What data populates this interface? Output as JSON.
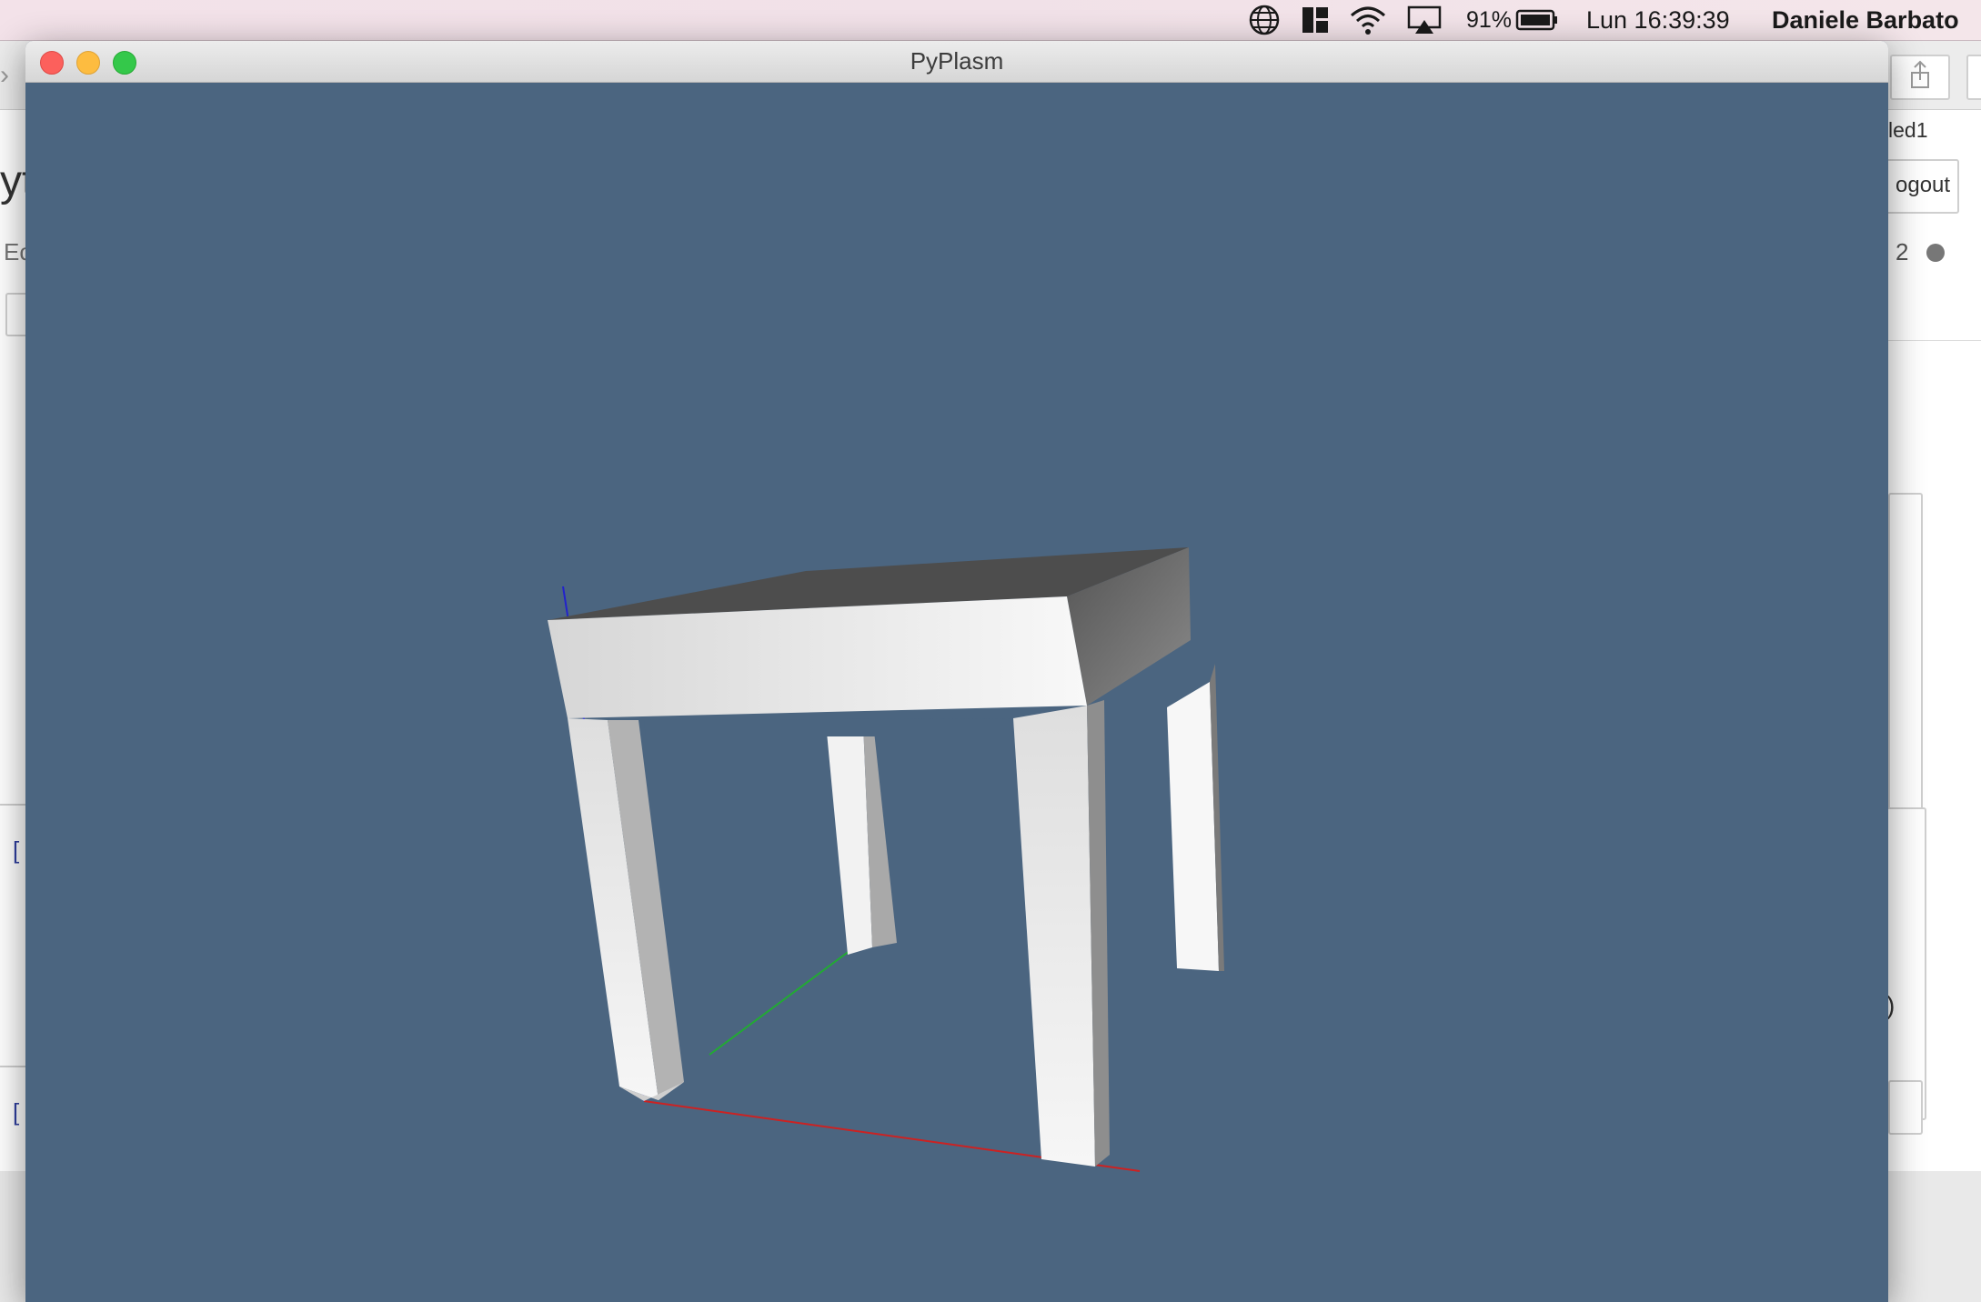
{
  "menubar": {
    "battery_percent": "91%",
    "clock": "Lun 16:39:39",
    "user": "Daniele Barbato",
    "icons": [
      "globe-icon",
      "app-switcher-icon",
      "wifi-icon",
      "airplay-icon",
      "battery-icon"
    ]
  },
  "background_app": {
    "tab_fragment": "led1",
    "logout_fragment": "ogout",
    "kernel_fragment": "2",
    "left_title_fragment": "yt",
    "left_menu_fragment": "Ec",
    "cell_bracket_1": "[",
    "cell_bracket_2": "[",
    "right_paren": ")"
  },
  "window": {
    "title": "PyPlasm",
    "buttons": [
      "close",
      "minimize",
      "zoom"
    ]
  },
  "viewer": {
    "background_color": "#4b6580",
    "object": "table",
    "axes_colors": {
      "x": "#cc2222",
      "y": "#22aa33",
      "z": "#2222cc"
    }
  }
}
